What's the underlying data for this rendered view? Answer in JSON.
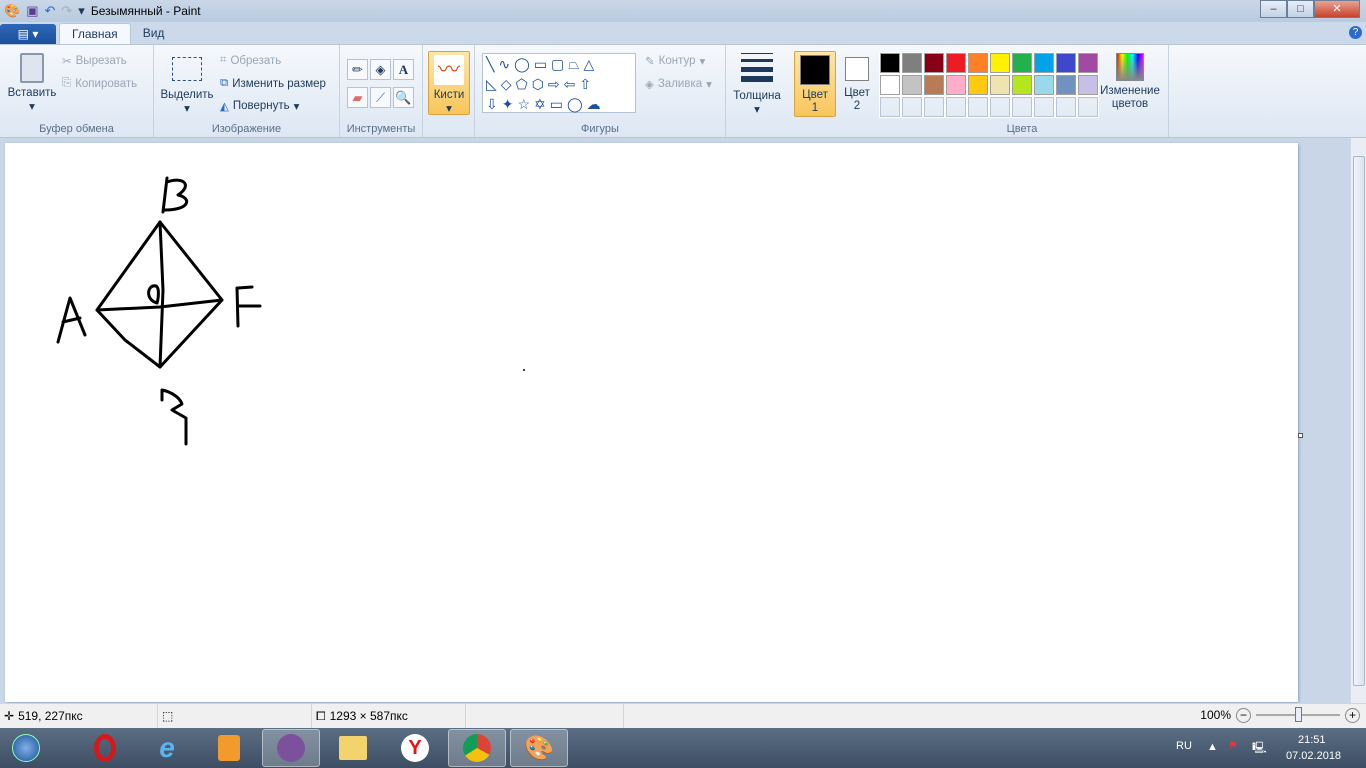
{
  "window": {
    "title": "Безымянный - Paint",
    "minimize": "–",
    "maximize": "□",
    "close": "✕"
  },
  "tabs": {
    "file": "▤ ▾",
    "home": "Главная",
    "view": "Вид",
    "help": "?"
  },
  "ribbon": {
    "clipboard": {
      "paste": "Вставить",
      "cut": "Вырезать",
      "copy": "Копировать",
      "label": "Буфер обмена"
    },
    "image": {
      "select": "Выделить",
      "crop": "Обрезать",
      "resize": "Изменить размер",
      "rotate": "Повернуть",
      "label": "Изображение"
    },
    "tools": {
      "label": "Инструменты"
    },
    "brushes": {
      "label": "Кисти"
    },
    "shapes": {
      "outline": "Контур",
      "fill": "Заливка",
      "label": "Фигуры"
    },
    "size": {
      "label": "Толщина"
    },
    "color1": {
      "label": "Цвет 1",
      "value": "#000000"
    },
    "color2": {
      "label": "Цвет 2",
      "value": "#ffffff"
    },
    "colors": {
      "label": "Цвета",
      "edit": "Изменение цветов",
      "row1": [
        "#000000",
        "#7f7f7f",
        "#880015",
        "#ed1c24",
        "#ff7f27",
        "#fff200",
        "#22b14c",
        "#00a2e8",
        "#3f48cc",
        "#a349a4"
      ],
      "row2": [
        "#ffffff",
        "#c3c3c3",
        "#b97a57",
        "#ffaec9",
        "#ffc90e",
        "#efe4b0",
        "#b5e61d",
        "#99d9ea",
        "#7092be",
        "#c8bfe7"
      ]
    }
  },
  "status": {
    "cursor": "519, 227пкс",
    "canvas_size": "1293 × 587пкс",
    "zoom": "100%",
    "zoom_level": 100
  },
  "taskbar": {
    "lang": "RU",
    "time": "21:51",
    "date": "07.02.2018"
  }
}
